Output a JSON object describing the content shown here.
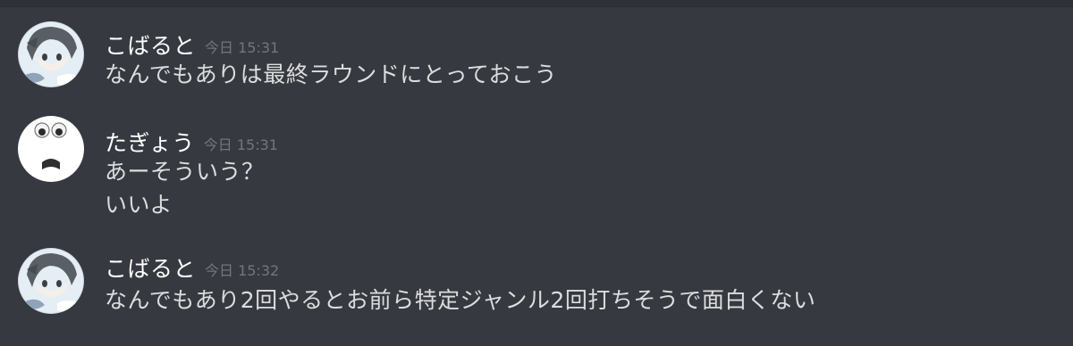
{
  "messages": [
    {
      "author": "こばると",
      "timestamp": "今日 15:31",
      "avatar_icon": "anime-character-avatar-icon",
      "lines": [
        "なんでもありは最終ラウンドにとっておこう"
      ]
    },
    {
      "author": "たぎょう",
      "timestamp": "今日 15:31",
      "avatar_icon": "surprised-face-avatar-icon",
      "lines": [
        "あーそういう？",
        "いいよ"
      ]
    },
    {
      "author": "こばると",
      "timestamp": "今日 15:32",
      "avatar_icon": "anime-character-avatar-icon",
      "lines": [
        "なんでもあり2回やるとお前ら特定ジャンル2回打ちそうで面白くない"
      ]
    }
  ],
  "colors": {
    "background": "#36393f",
    "author_text": "#ffffff",
    "message_text": "#dcddde",
    "timestamp_text": "#72767d"
  }
}
